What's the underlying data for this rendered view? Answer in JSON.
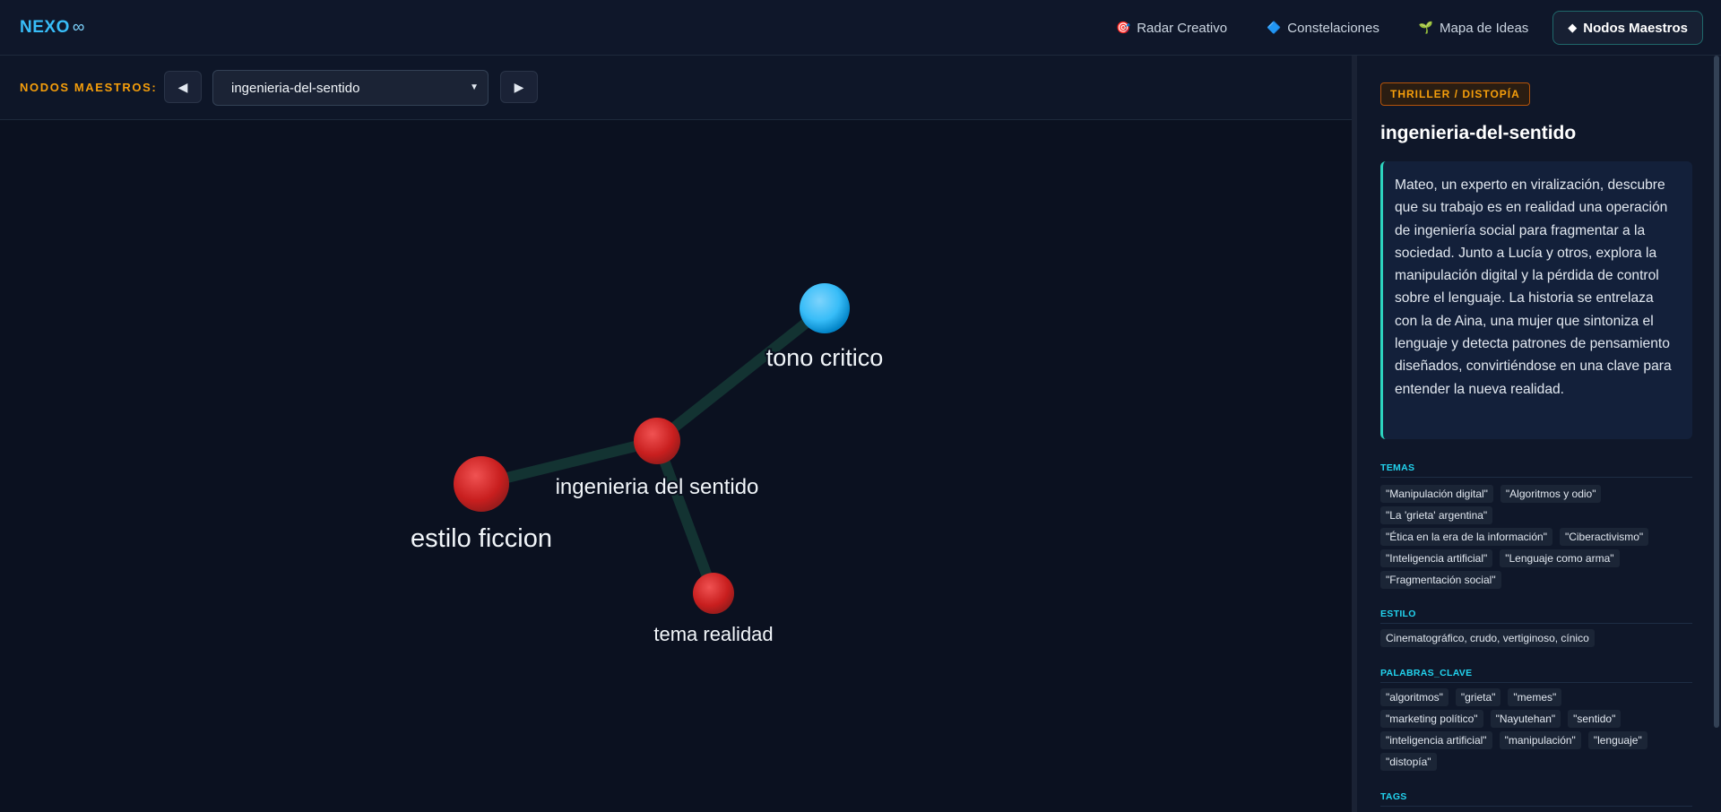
{
  "app": {
    "logo": "NEXO",
    "logo_symbol": "∞"
  },
  "nav": [
    {
      "icon": "🎯",
      "label": "Radar Creativo",
      "active": false
    },
    {
      "icon": "🔷",
      "label": "Constelaciones",
      "active": false
    },
    {
      "icon": "🌱",
      "label": "Mapa de Ideas",
      "active": false
    },
    {
      "icon": "◆",
      "label": "Nodos Maestros",
      "active": true
    }
  ],
  "toolbar": {
    "label": "NODOS MAESTROS:",
    "prev": "◀",
    "next": "▶",
    "selected": "ingenieria-del-sentido"
  },
  "graph": {
    "nodes": [
      {
        "id": "tono",
        "label": "tono critico",
        "color": "blue"
      },
      {
        "id": "ing",
        "label": "ingenieria del sentido",
        "color": "red"
      },
      {
        "id": "estilo",
        "label": "estilo ficcion",
        "color": "red"
      },
      {
        "id": "tema",
        "label": "tema realidad",
        "color": "red"
      }
    ],
    "edges": [
      [
        "ing",
        "tono"
      ],
      [
        "ing",
        "estilo"
      ],
      [
        "ing",
        "tema"
      ]
    ]
  },
  "panel": {
    "genre": "THRILLER / DISTOPÍA",
    "title": "ingenieria-del-sentido",
    "synopsis": "Mateo, un experto en viralización, descubre que su trabajo es en realidad una operación de ingeniería social para fragmentar a la sociedad. Junto a Lucía y otros, explora la manipulación digital y la pérdida de control sobre el lenguaje. La historia se entrelaza con la de Aina, una mujer que sintoniza el lenguaje y detecta patrones de pensamiento diseñados, convirtiéndose en una clave para entender la nueva realidad.",
    "sections": {
      "temas": {
        "title": "TEMAS",
        "items": [
          "\"Manipulación digital\"",
          "\"Algoritmos y odio\"",
          "\"La 'grieta' argentina\"",
          "\"Ética en la era de la información\"",
          "\"Ciberactivismo\"",
          "\"Inteligencia artificial\"",
          "\"Lenguaje como arma\"",
          "\"Fragmentación social\""
        ]
      },
      "estilo": {
        "title": "ESTILO",
        "items": [
          "Cinematográfico, crudo, vertiginoso, cínico"
        ]
      },
      "palabras": {
        "title": "PALABRAS_CLAVE",
        "items": [
          "\"algoritmos\"",
          "\"grieta\"",
          "\"memes\"",
          "\"marketing político\"",
          "\"Nayutehan\"",
          "\"sentido\"",
          "\"inteligencia artificial\"",
          "\"manipulación\"",
          "\"lenguaje\"",
          "\"distopía\""
        ]
      },
      "tags": {
        "title": "TAGS",
        "items": []
      }
    }
  }
}
